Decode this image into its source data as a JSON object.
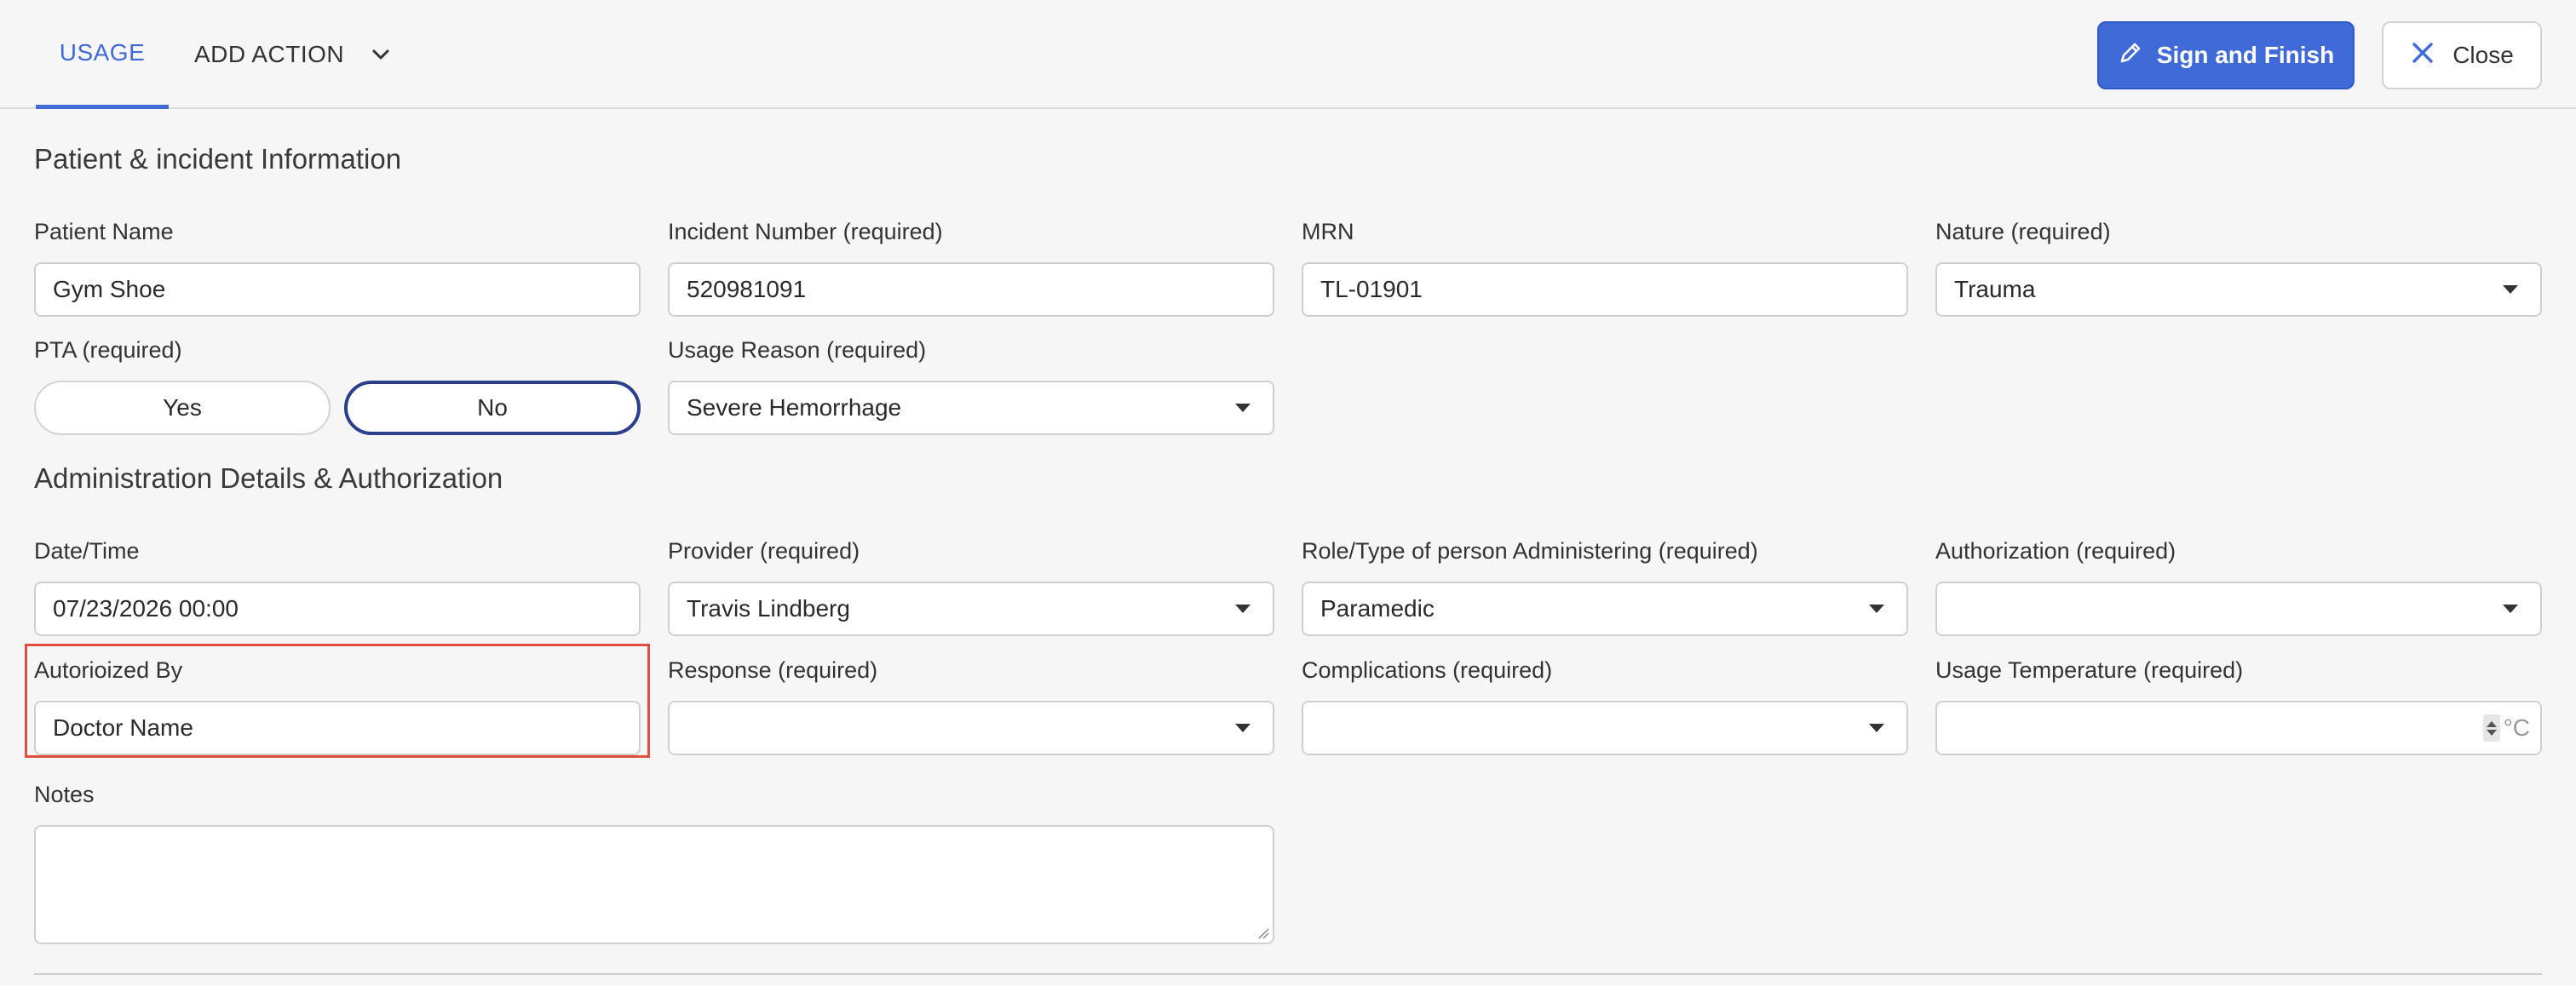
{
  "header": {
    "tabs": [
      {
        "label": "USAGE",
        "active": true
      },
      {
        "label": "ADD ACTION",
        "active": false
      }
    ],
    "sign_label": "Sign and Finish",
    "close_label": "Close",
    "accent_color": "#3f6ad8"
  },
  "sections": {
    "patient_title": "Patient & incident Information",
    "admin_title": "Administration Details & Authorization"
  },
  "patient": {
    "name": {
      "label": "Patient Name",
      "value": "Gym Shoe"
    },
    "incident": {
      "label": "Incident Number (required)",
      "value": "520981091"
    },
    "mrn": {
      "label": "MRN",
      "value": "TL-01901"
    },
    "nature": {
      "label": "Nature (required)",
      "value": "Trauma"
    },
    "pta": {
      "label": "PTA (required)",
      "yes": "Yes",
      "no": "No",
      "selected": "No"
    },
    "usage_reason": {
      "label": "Usage Reason (required)",
      "value": "Severe Hemorrhage"
    }
  },
  "admin": {
    "datetime": {
      "label": "Date/Time",
      "value": "07/23/2026 00:00"
    },
    "provider": {
      "label": "Provider (required)",
      "value": "Travis Lindberg"
    },
    "role": {
      "label": "Role/Type of person Administering (required)",
      "value": "Paramedic"
    },
    "authorization": {
      "label": "Authorization (required)",
      "value": ""
    },
    "authorized_by": {
      "label": "Autorioized By",
      "value": "Doctor Name",
      "highlight_color": "#e34c3c"
    },
    "response": {
      "label": "Response (required)",
      "value": ""
    },
    "complications": {
      "label": "Complications (required)",
      "value": ""
    },
    "temperature": {
      "label": "Usage Temperature (required)",
      "value": "",
      "unit": "°C"
    },
    "notes": {
      "label": "Notes",
      "value": ""
    }
  }
}
